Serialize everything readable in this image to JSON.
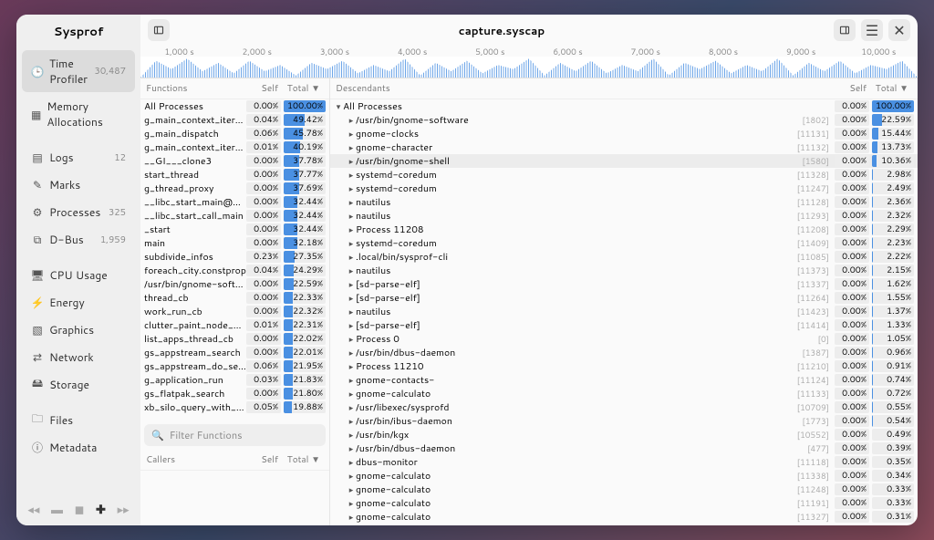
{
  "app_title": "Sysprof",
  "file_title": "capture.syscap",
  "sidebar": {
    "groups": [
      [
        {
          "icon": "clock",
          "label": "Time Profiler",
          "count": "30,487",
          "active": true
        },
        {
          "icon": "mem",
          "label": "Memory Allocations",
          "count": ""
        }
      ],
      [
        {
          "icon": "logs",
          "label": "Logs",
          "count": "12"
        },
        {
          "icon": "marks",
          "label": "Marks",
          "count": ""
        },
        {
          "icon": "proc",
          "label": "Processes",
          "count": "325"
        },
        {
          "icon": "dbus",
          "label": "D-Bus",
          "count": "1,959"
        }
      ],
      [
        {
          "icon": "cpu",
          "label": "CPU Usage",
          "count": ""
        },
        {
          "icon": "energy",
          "label": "Energy",
          "count": ""
        },
        {
          "icon": "gfx",
          "label": "Graphics",
          "count": ""
        },
        {
          "icon": "net",
          "label": "Network",
          "count": ""
        },
        {
          "icon": "disk",
          "label": "Storage",
          "count": ""
        }
      ],
      [
        {
          "icon": "files",
          "label": "Files",
          "count": ""
        },
        {
          "icon": "meta",
          "label": "Metadata",
          "count": ""
        }
      ]
    ]
  },
  "timeline": [
    "1,000 s",
    "2,000 s",
    "3,000 s",
    "4,000 s",
    "5,000 s",
    "6,000 s",
    "7,000 s",
    "8,000 s",
    "9,000 s",
    "10,000 s"
  ],
  "left_header": {
    "c1": "Functions",
    "self": "Self",
    "total": "Total ▼"
  },
  "callers_header": {
    "c1": "Callers",
    "self": "Self",
    "total": "Total ▼"
  },
  "right_header": {
    "c1": "Descendants",
    "self": "Self",
    "total": "Total ▼"
  },
  "filter_placeholder": "Filter Functions",
  "functions": [
    {
      "name": "All Processes",
      "self": "0.00%",
      "total": "100.00%",
      "bar": 100
    },
    {
      "name": "g_main_context_iterate",
      "self": "0.04%",
      "total": "49.42%",
      "bar": 49
    },
    {
      "name": "g_main_dispatch",
      "self": "0.06%",
      "total": "45.78%",
      "bar": 46
    },
    {
      "name": "g_main_context_iterate",
      "self": "0.01%",
      "total": "40.19%",
      "bar": 40
    },
    {
      "name": "__GI___clone3",
      "self": "0.00%",
      "total": "37.78%",
      "bar": 38
    },
    {
      "name": "start_thread",
      "self": "0.00%",
      "total": "37.77%",
      "bar": 38
    },
    {
      "name": "g_thread_proxy",
      "self": "0.00%",
      "total": "37.69%",
      "bar": 38
    },
    {
      "name": "__libc_start_main@GLIBC",
      "self": "0.00%",
      "total": "32.44%",
      "bar": 32
    },
    {
      "name": "__libc_start_call_main",
      "self": "0.00%",
      "total": "32.44%",
      "bar": 32
    },
    {
      "name": "_start",
      "self": "0.00%",
      "total": "32.44%",
      "bar": 32
    },
    {
      "name": "main",
      "self": "0.00%",
      "total": "32.18%",
      "bar": 32
    },
    {
      "name": "subdivide_infos",
      "self": "0.23%",
      "total": "27.35%",
      "bar": 27
    },
    {
      "name": "foreach_city.constprop",
      "self": "0.04%",
      "total": "24.29%",
      "bar": 24
    },
    {
      "name": "/usr/bin/gnome-software",
      "self": "0.00%",
      "total": "22.59%",
      "bar": 23
    },
    {
      "name": "thread_cb",
      "self": "0.00%",
      "total": "22.33%",
      "bar": 22
    },
    {
      "name": "work_run_cb",
      "self": "0.00%",
      "total": "22.32%",
      "bar": 22
    },
    {
      "name": "clutter_paint_node_paint",
      "self": "0.01%",
      "total": "22.31%",
      "bar": 22
    },
    {
      "name": "list_apps_thread_cb",
      "self": "0.00%",
      "total": "22.02%",
      "bar": 22
    },
    {
      "name": "gs_appstream_search",
      "self": "0.00%",
      "total": "22.01%",
      "bar": 22
    },
    {
      "name": "gs_appstream_do_search",
      "self": "0.06%",
      "total": "21.95%",
      "bar": 22
    },
    {
      "name": "g_application_run",
      "self": "0.03%",
      "total": "21.83%",
      "bar": 22
    },
    {
      "name": "gs_flatpak_search",
      "self": "0.00%",
      "total": "21.80%",
      "bar": 22
    },
    {
      "name": "xb_silo_query_with_root",
      "self": "0.05%",
      "total": "19.88%",
      "bar": 20
    }
  ],
  "descendants": [
    {
      "name": "All Processes",
      "pid": "",
      "self": "0.00%",
      "total": "100.00%",
      "bar": 100,
      "level": 0,
      "open": true
    },
    {
      "name": "/usr/bin/gnome-software",
      "pid": "[1802]",
      "self": "0.00%",
      "total": "22.59%",
      "bar": 23,
      "level": 1
    },
    {
      "name": "gnome-clocks",
      "pid": "[11131]",
      "self": "0.00%",
      "total": "15.44%",
      "bar": 15,
      "level": 1
    },
    {
      "name": "gnome-character",
      "pid": "[11132]",
      "self": "0.00%",
      "total": "13.73%",
      "bar": 14,
      "level": 1
    },
    {
      "name": "/usr/bin/gnome-shell",
      "pid": "[1580]",
      "self": "0.00%",
      "total": "10.36%",
      "bar": 10,
      "level": 1,
      "sel": true
    },
    {
      "name": "systemd-coredum",
      "pid": "[11328]",
      "self": "0.00%",
      "total": "2.98%",
      "bar": 3,
      "level": 1
    },
    {
      "name": "systemd-coredum",
      "pid": "[11247]",
      "self": "0.00%",
      "total": "2.49%",
      "bar": 2,
      "level": 1
    },
    {
      "name": "nautilus",
      "pid": "[11128]",
      "self": "0.00%",
      "total": "2.36%",
      "bar": 2,
      "level": 1
    },
    {
      "name": "nautilus",
      "pid": "[11293]",
      "self": "0.00%",
      "total": "2.32%",
      "bar": 2,
      "level": 1
    },
    {
      "name": "Process 11208",
      "pid": "[11208]",
      "self": "0.00%",
      "total": "2.29%",
      "bar": 2,
      "level": 1
    },
    {
      "name": "systemd-coredum",
      "pid": "[11409]",
      "self": "0.00%",
      "total": "2.23%",
      "bar": 2,
      "level": 1
    },
    {
      "name": ".local/bin/sysprof-cli",
      "pid": "[11085]",
      "self": "0.00%",
      "total": "2.22%",
      "bar": 2,
      "level": 1
    },
    {
      "name": "nautilus",
      "pid": "[11373]",
      "self": "0.00%",
      "total": "2.15%",
      "bar": 2,
      "level": 1
    },
    {
      "name": "[sd-parse-elf]",
      "pid": "[11337]",
      "self": "0.00%",
      "total": "1.62%",
      "bar": 2,
      "level": 1
    },
    {
      "name": "[sd-parse-elf]",
      "pid": "[11264]",
      "self": "0.00%",
      "total": "1.55%",
      "bar": 2,
      "level": 1
    },
    {
      "name": "nautilus",
      "pid": "[11423]",
      "self": "0.00%",
      "total": "1.37%",
      "bar": 1,
      "level": 1
    },
    {
      "name": "[sd-parse-elf]",
      "pid": "[11414]",
      "self": "0.00%",
      "total": "1.33%",
      "bar": 1,
      "level": 1
    },
    {
      "name": "Process 0",
      "pid": "[0]",
      "self": "0.00%",
      "total": "1.05%",
      "bar": 1,
      "level": 1
    },
    {
      "name": "/usr/bin/dbus-daemon",
      "pid": "[1387]",
      "self": "0.00%",
      "total": "0.96%",
      "bar": 1,
      "level": 1
    },
    {
      "name": "Process 11210",
      "pid": "[11210]",
      "self": "0.00%",
      "total": "0.91%",
      "bar": 1,
      "level": 1
    },
    {
      "name": "gnome-contacts-",
      "pid": "[11124]",
      "self": "0.00%",
      "total": "0.74%",
      "bar": 1,
      "level": 1
    },
    {
      "name": "gnome-calculato",
      "pid": "[11133]",
      "self": "0.00%",
      "total": "0.72%",
      "bar": 1,
      "level": 1
    },
    {
      "name": "/usr/libexec/sysprofd",
      "pid": "[10709]",
      "self": "0.00%",
      "total": "0.55%",
      "bar": 1,
      "level": 1
    },
    {
      "name": "/usr/bin/ibus-daemon",
      "pid": "[1773]",
      "self": "0.00%",
      "total": "0.54%",
      "bar": 1,
      "level": 1
    },
    {
      "name": "/usr/bin/kgx",
      "pid": "[10552]",
      "self": "0.00%",
      "total": "0.49%",
      "bar": 0,
      "level": 1
    },
    {
      "name": "/usr/bin/dbus-daemon",
      "pid": "[477]",
      "self": "0.00%",
      "total": "0.39%",
      "bar": 0,
      "level": 1
    },
    {
      "name": "dbus-monitor",
      "pid": "[11118]",
      "self": "0.00%",
      "total": "0.35%",
      "bar": 0,
      "level": 1
    },
    {
      "name": "gnome-calculato",
      "pid": "[11338]",
      "self": "0.00%",
      "total": "0.34%",
      "bar": 0,
      "level": 1
    },
    {
      "name": "gnome-calculato",
      "pid": "[11248]",
      "self": "0.00%",
      "total": "0.33%",
      "bar": 0,
      "level": 1
    },
    {
      "name": "gnome-calculato",
      "pid": "[11191]",
      "self": "0.00%",
      "total": "0.33%",
      "bar": 0,
      "level": 1
    },
    {
      "name": "gnome-calculato",
      "pid": "[11327]",
      "self": "0.00%",
      "total": "0.31%",
      "bar": 0,
      "level": 1
    }
  ]
}
